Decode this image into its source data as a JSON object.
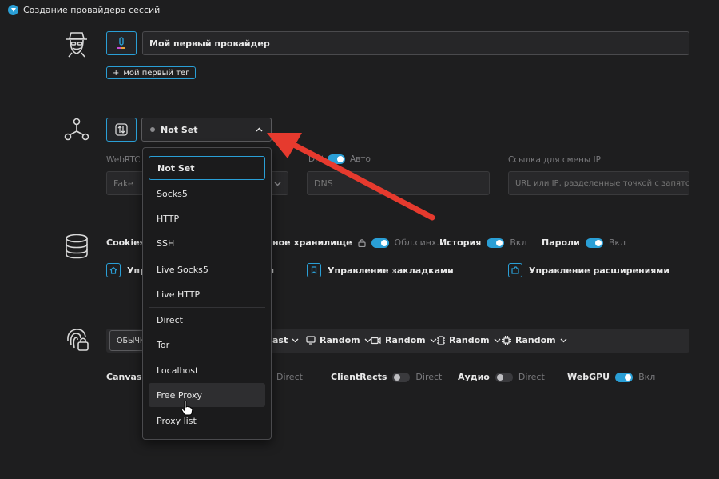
{
  "window": {
    "title": "Создание провайдера сессий"
  },
  "profile": {
    "name_value": "Мой первый провайдер",
    "tag_button": "мой первый тег",
    "tag_plus": "+"
  },
  "proxy": {
    "selected": "Not Set",
    "webrtc_label": "WebRTC",
    "webrtc_value": "Fake",
    "dns_label_fragment": "DNS",
    "dns_auto": "Авто",
    "dns_placeholder": "DNS",
    "ip_change_label": "Ссылка для смены IP",
    "ip_change_placeholder": "URL или IP, разделенные точкой с запятой",
    "options": [
      {
        "label": "Not Set"
      },
      {
        "label": "Socks5"
      },
      {
        "label": "HTTP"
      },
      {
        "label": "SSH"
      },
      {
        "label": "Live Socks5"
      },
      {
        "label": "Live HTTP"
      },
      {
        "label": "Direct"
      },
      {
        "label": "Tor"
      },
      {
        "label": "Localhost"
      },
      {
        "label": "Free Proxy"
      },
      {
        "label": "Proxy list"
      }
    ]
  },
  "storage": {
    "cookies": "Cookies",
    "local_storage": "ное хранилище",
    "local_storage_sub": "Обл.синх.",
    "history": "История",
    "history_sub": "Вкл",
    "passwords": "Пароли",
    "passwords_sub": "Вкл",
    "manage_truncated": "Упр",
    "manage_truncated_tail": "и",
    "bookmarks": "Управление закладками",
    "extensions": "Управление расширениями"
  },
  "fingerprint": {
    "mode_pill": "ОБЫЧН",
    "items": [
      {
        "label": "ast"
      },
      {
        "label": "Random"
      },
      {
        "label": "Random"
      },
      {
        "label": "Random"
      },
      {
        "label": "Random"
      }
    ],
    "canvas": "Canvas",
    "canvas_sub": "Direct",
    "clientrects": "ClientRects",
    "clientrects_sub": "Direct",
    "audio": "Аудио",
    "audio_sub": "Direct",
    "webgpu": "WebGPU",
    "webgpu_sub": "Вкл"
  },
  "colors": {
    "accent": "#2a9fd6",
    "arrow": "#e63a2e",
    "background": "#1e1e1f"
  }
}
